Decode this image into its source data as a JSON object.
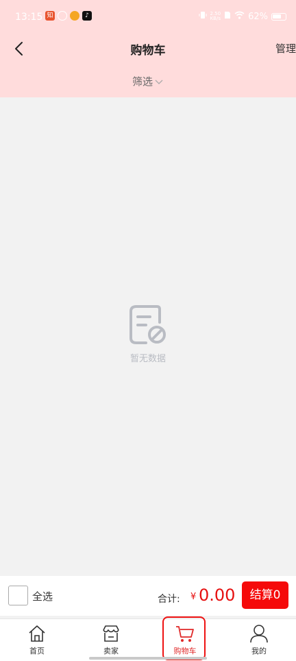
{
  "status_bar": {
    "time": "13:15",
    "network_speed_value": "2.50",
    "network_speed_unit": "KB/s",
    "battery_percent": "62%"
  },
  "nav": {
    "title": "购物车",
    "manage_label": "管理"
  },
  "filter": {
    "label": "筛选"
  },
  "empty_state": {
    "text": "暂无数据"
  },
  "checkout": {
    "select_all_label": "全选",
    "total_label": "合计:",
    "currency": "¥",
    "total_amount": "0.00",
    "checkout_label": "结算0"
  },
  "tabs": [
    {
      "label": "首页",
      "icon": "home-icon"
    },
    {
      "label": "卖家",
      "icon": "shop-icon"
    },
    {
      "label": "购物车",
      "icon": "cart-icon",
      "active": true
    },
    {
      "label": "我的",
      "icon": "user-icon"
    }
  ],
  "colors": {
    "header_bg": "#ffdcdc",
    "accent": "#f50a0a",
    "page_bg": "#f2f2f2"
  }
}
